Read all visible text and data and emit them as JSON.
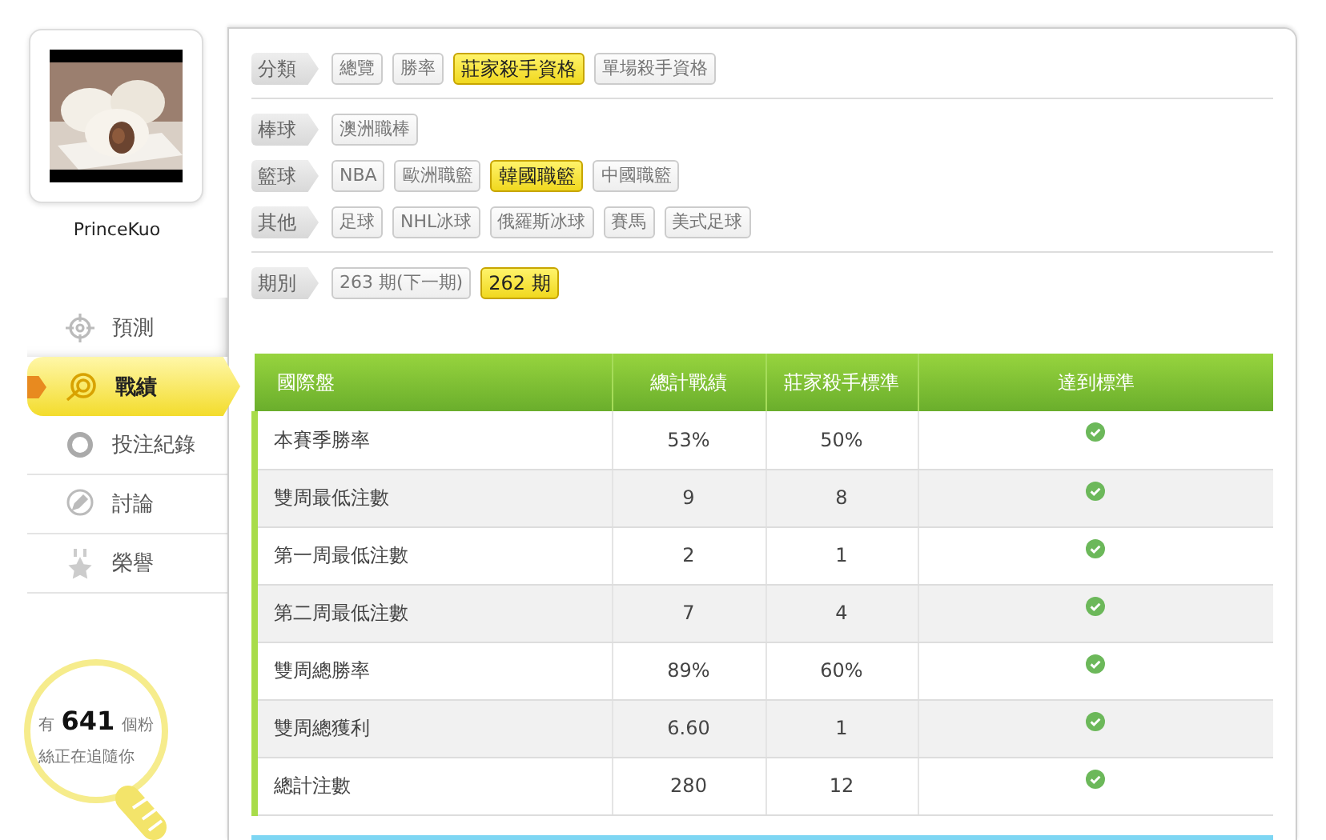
{
  "user": {
    "name": "PrinceKuo"
  },
  "nav": [
    {
      "label": "預測",
      "selected": false
    },
    {
      "label": "戰績",
      "selected": true
    },
    {
      "label": "投注紀錄",
      "selected": false
    },
    {
      "label": "討論",
      "selected": false
    },
    {
      "label": "榮譽",
      "selected": false
    }
  ],
  "fans": {
    "text": "有 **641** 個粉絲正在追隨你"
  },
  "filter_sections": [
    [
      {
        "label": "分類",
        "options": [
          {
            "label": "總覽",
            "selected": false
          },
          {
            "label": "勝率",
            "selected": false
          },
          {
            "label": "莊家殺手資格",
            "selected": true
          },
          {
            "label": "單場殺手資格",
            "selected": false
          }
        ]
      }
    ],
    [
      {
        "label": "棒球",
        "options": [
          {
            "label": "澳洲職棒",
            "selected": false
          }
        ]
      },
      {
        "label": "籃球",
        "options": [
          {
            "label": "NBA",
            "selected": false
          },
          {
            "label": "歐洲職籃",
            "selected": false
          },
          {
            "label": "韓國職籃",
            "selected": true
          },
          {
            "label": "中國職籃",
            "selected": false
          }
        ]
      },
      {
        "label": "其他",
        "options": [
          {
            "label": "足球",
            "selected": false
          },
          {
            "label": "NHL冰球",
            "selected": false
          },
          {
            "label": "俄羅斯冰球",
            "selected": false
          },
          {
            "label": "賽馬",
            "selected": false
          },
          {
            "label": "美式足球",
            "selected": false
          }
        ]
      }
    ],
    [
      {
        "label": "期別",
        "options": [
          {
            "label": "263 期(下一期)",
            "selected": false
          },
          {
            "label": "262 期",
            "selected": true
          }
        ]
      }
    ]
  ],
  "table": {
    "columns": [
      "國際盤",
      "總計戰績",
      "莊家殺手標準",
      "達到標準"
    ],
    "rows": [
      {
        "item": "本賽季勝率",
        "total": "53%",
        "standard": "50%",
        "met": true
      },
      {
        "item": "雙周最低注數",
        "total": "9",
        "standard": "8",
        "met": true
      },
      {
        "item": "第一周最低注數",
        "total": "2",
        "standard": "1",
        "met": true
      },
      {
        "item": "第二周最低注數",
        "total": "7",
        "standard": "4",
        "met": true
      },
      {
        "item": "雙周總勝率",
        "total": "89%",
        "standard": "60%",
        "met": true
      },
      {
        "item": "雙周總獲利",
        "total": "6.60",
        "standard": "1",
        "met": true
      },
      {
        "item": "總計注數",
        "total": "280",
        "standard": "12",
        "met": true
      }
    ]
  }
}
